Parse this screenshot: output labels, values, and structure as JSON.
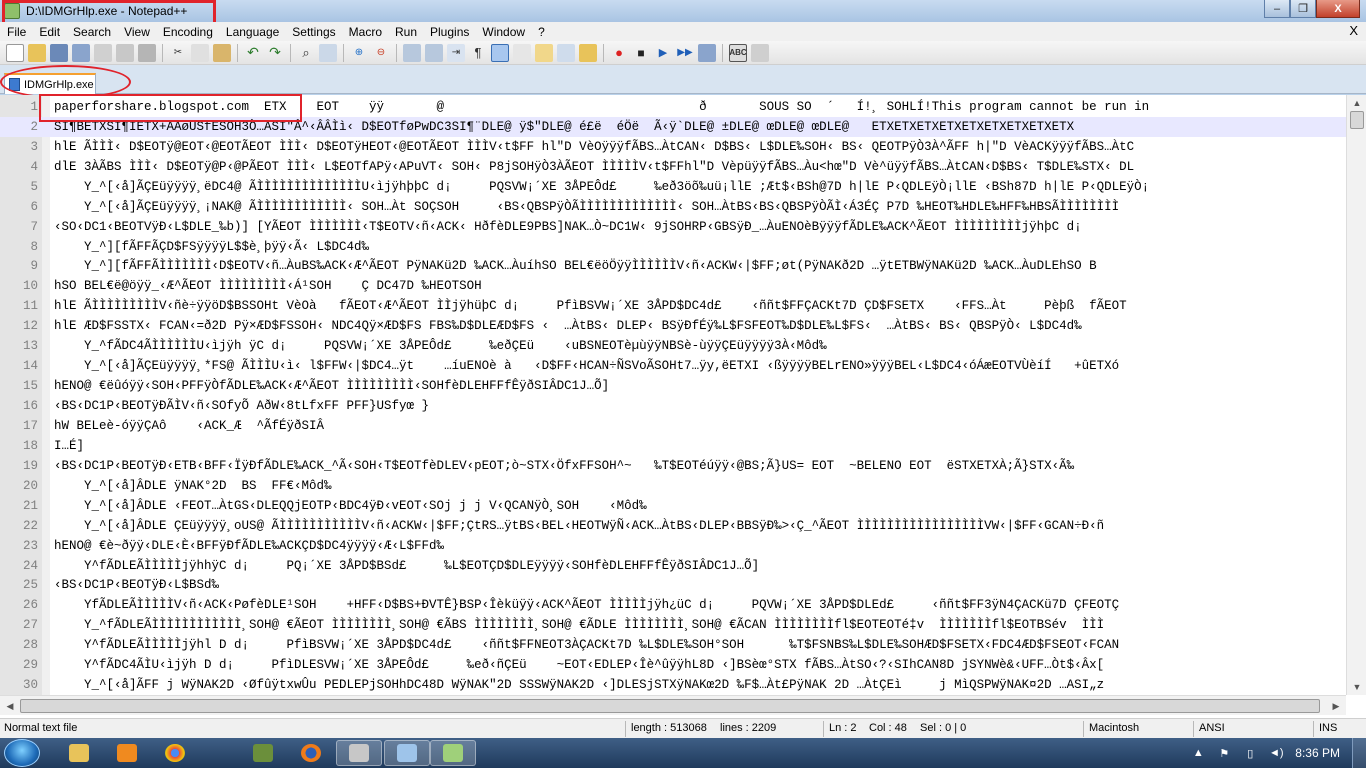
{
  "window": {
    "title": "D:\\IDMGrHlp.exe - Notepad++",
    "controls": {
      "minimize": "–",
      "maximize": "❐",
      "close": "X"
    }
  },
  "menu": [
    "File",
    "Edit",
    "Search",
    "View",
    "Encoding",
    "Language",
    "Settings",
    "Macro",
    "Run",
    "Plugins",
    "Window",
    "?"
  ],
  "menu_close": "X",
  "toolbar": {
    "icons": [
      "new-file-icon",
      "open-file-icon",
      "save-icon",
      "save-all-icon",
      "close-icon",
      "close-all-icon",
      "print-icon",
      "cut-icon",
      "copy-icon",
      "paste-icon",
      "undo-icon",
      "redo-icon",
      "find-icon",
      "replace-icon",
      "zoom-in-icon",
      "zoom-out-icon",
      "sync-vertical-icon",
      "sync-horizontal-icon",
      "word-wrap-icon",
      "show-all-chars-icon",
      "indent-guide-icon",
      "user-lang-icon",
      "doc-map-icon",
      "function-list-icon",
      "folder-workspace-icon",
      "record-macro-icon",
      "stop-macro-icon",
      "play-macro-icon",
      "run-macro-multiple-icon",
      "save-macro-icon",
      "spellcheck-icon",
      "settings-icon"
    ],
    "spellcheck_label": "ABC"
  },
  "tab": {
    "label": "IDMGrHlp.exe"
  },
  "editor": {
    "current_line": 2,
    "lines": [
      {
        "n": "1",
        "text": "paperforshare.blogspot.com  ETX    EOT    ÿÿ       @                                  ð       SOUS SO  ´   Í!¸ SOHLÍ!This program cannot be run in"
      },
      {
        "n": "2",
        "text": "SI¶BETXSI¶IETX+AAøUSfESOH3Ò…ASI\"Â^‹ÂÂÌì‹ D$EOTføPwDC3SI¶¨DLE@ ÿ$\"DLE@ é£ë  éÖë  Ã‹ÿ`DLE@ ±DLE@ œDLE@ œDLE@   ETXETXETXETXETXETXETXETXETX"
      },
      {
        "n": "3",
        "text": "hlE ÃÌÌÌ‹ D$EOTÿ@EOT‹@EOTÃEOT ÌÌÌ‹ D$EOTÿHEOT‹@EOTÃEOT ÌÌÌV‹t$FF hl\"D VèOÿÿÿfÃBS…ÀtCAN‹ D$BS‹ L$DLE‰SOH‹ BS‹ QEOTPÿÒ3À^ÃFF h|\"D VèACKÿÿÿfÃBS…ÀtC"
      },
      {
        "n": "4",
        "text": "dlE 3ÀÃBS ÌÌÌ‹ D$EOTÿ@P‹@PÃEOT ÌÌÌ‹ L$EOTfAPÿ‹APuVT‹ SOH‹ P8jSOHÿÒ3ÀÃEOT ÌÌÌÌÌV‹t$FFhl\"D VèpüÿÿfÃBS…Àu<hœ\"D Vè^üÿÿfÃBS…ÀtCAN‹D$BS‹ T$DLE‰STX‹ DL"
      },
      {
        "n": "5",
        "text": "    Y_^[‹å]ÃÇEüÿÿÿÿ¸ëDC4@ ÃÌÌÌÌÌÌÌÌÌÌÌÌÌÌU‹ìjÿhþþC d¡     PQSVW¡´XE 3ÅPEÔd£     ‰eð3öõ‰uü¡llE ;Æt$‹BSh@7D h|lE P‹QDLEÿÒ¡llE ‹BSh87D h|lE P‹QDLEÿÒ¡"
      },
      {
        "n": "6",
        "text": "    Y_^[‹å]ÃÇEüÿÿÿÿ¸¡NAK@ ÃÌÌÌÌÌÌÌÌÌÌÌÌ‹ SOH…Àt SOÇSOH     ‹BS‹QBSPÿÒÃÌÌÌÌÌÌÌÌÌÌÌÌÌ‹ SOH…ÀtBS‹BS‹QBSPÿÒÃÌ‹Á3ÉÇ P7D ‰HEOT‰HDLE‰HFF‰HBSÃÌÌÌÌÌÌÌÌ"
      },
      {
        "n": "7",
        "text": "‹SO‹DC1‹BEOTVÿÐ‹L$DLE_‰b)] [YÃEOT ÌÌÌÌÌÌÌ‹T$EOTV‹ñ‹ACK‹ HðfèDLE9PBS]NAK…Ò~DC1W‹ 9jSOHRP‹GBSÿÐ_…ÀuENOèBÿÿÿfÃDLE‰ACK^ÃEOT ÌÌÌÌÌÌÌÌÌjÿhþC d¡"
      },
      {
        "n": "8",
        "text": "    Y_^][fÃFFÃÇD$FSÿÿÿÿL$$è¸þÿÿ‹Ã‹ L$DC4d‰"
      },
      {
        "n": "9",
        "text": "    Y_^][fÃFFÃÌÌÌÌÌÌÌ‹D$EOTV‹ñ…ÀuBS‰ACK‹Æ^ÃEOT PÿNAKü2D ‰ACK…ÀuíhSO BEL€ëöÖÿÿÌÌÌÌÌÌV‹ñ‹ACKW‹|$FF;øt(PÿNAKð2D …ÿtETBWÿNAKü2D ‰ACK…ÀuDLEhSO B"
      },
      {
        "n": "10",
        "text": "hSO BEL€ë@öÿÿ_‹Æ^ÃEOT ÌÌÌÌÌÌÌÌÌ‹Á¹SOH    Ç DC47D ‰HEOTSOH"
      },
      {
        "n": "11",
        "text": "hlE ÃÌÌÌÌÌÌÌÌÌV‹ñè÷ÿÿöD$BSSOHt VèOà   fÃEOT‹Æ^ÃEOT ÌÌjÿhüþC d¡     PfìBSVW¡´XE 3ÅPD$DC4d£    ‹ññt$FFÇACKt7D ÇD$FSETX    ‹FFS…Àt     Pèþß  fÃEOT"
      },
      {
        "n": "12",
        "text": "hlE ÆD$FSSTX‹ FCAN‹=ð2D Pÿ×ÆD$FSSOH‹ NDC4Qÿ×ÆD$FS FBS‰D$DLEÆD$FS ‹  …ÀtBS‹ DLEP‹ BSÿÐfÉÿ‰L$FSFEOT‰D$DLE‰L$FS‹  …ÀtBS‹ BS‹ QBSPÿÒ‹ L$DC4d‰"
      },
      {
        "n": "13",
        "text": "    Y_^fÃDC4ÃÌÌÌÌÌÌU‹ìjÿh ÿC d¡     PQSVW¡´XE 3ÅPEÔd£     ‰eðÇEü    ‹uBSNEOTèµùÿÿNBSè-ùÿÿÇEüÿÿÿÿ3À‹Môd‰"
      },
      {
        "n": "14",
        "text": "    Y_^[‹å]ÃÇEüÿÿÿÿ¸*FS@ ÃÌÌÌU‹ì‹ l$FFW‹|$DC4…ÿt    …íuENOè à   ‹D$FF‹HCAN÷ÑSVoÃSOHt7…ÿy,ëETXI ‹ßÿÿÿÿBELrENO»ÿÿÿBEL‹L$DC4‹óÁæEOTVÙèíÍ   +ûETXó"
      },
      {
        "n": "15",
        "text": "hENO@ €ëûóÿÿ‹SOH‹PFFÿÒfÃDLE‰ACK‹Æ^ÃEOT ÌÌÌÌÌÌÌÌÌ‹SOHfèDLEHFFfÊÿðSIÂDC1J…Õ]"
      },
      {
        "n": "16",
        "text": "‹BS‹DC1P‹BEOTÿÐÃÌV‹ñ‹SOfyÕ AðW‹8tLfxFF PFF}USfyœ }"
      },
      {
        "n": "17",
        "text": "hW BELeè-óÿÿÇAô    ‹ACK_Æ  ^ÃfÉÿðSIÂ"
      },
      {
        "n": "18",
        "text": "I…É]"
      },
      {
        "n": "19",
        "text": "‹BS‹DC1P‹BEOTÿÐ‹ETB‹BFF‹ÏÿÐfÃDLE‰ACK_^Ã‹SOH‹T$EOTfèDLEV‹pEOT;ò~STX‹ÖfxFFSOH^~   ‰T$EOTéúÿÿ‹@BS;Ã}US= EOT  ~BELENO EOT  ëSTXETXÀ;Ã}STX‹Ã‰"
      },
      {
        "n": "20",
        "text": "    Y_^[‹å]ÂDLE ÿNAK°2D  BS  FF€‹Môd‰"
      },
      {
        "n": "21",
        "text": "    Y_^[‹å]ÂDLE ‹FEOT…ÀtGS‹DLEQQjEOTP‹BDC4ÿÐ‹vEOT‹SOj j j V‹QCANÿÒ¸SOH    ‹Môd‰"
      },
      {
        "n": "22",
        "text": "    Y_^[‹å]ÂDLE ÇEüÿÿÿÿ¸oUS@ ÃÌÌÌÌÌÌÌÌÌÌÌV‹ñ‹ACKW‹|$FF;ÇtRS…ÿtBS‹BEL‹HEOTWÿÑ‹ACK…ÀtBS‹DLEP‹BBSÿÐ‰>‹Ç_^ÃEOT ÌÌÌÌÌÌÌÌÌÌÌÌÌÌÌÌÌVW‹|$FF‹GCAN÷Ð‹ñ"
      },
      {
        "n": "23",
        "text": "hENO@ €è~ðÿÿ‹DLE‹È‹BFFÿÐfÃDLE‰ACKÇD$DC4ÿÿÿÿ‹Æ‹L$FFd‰"
      },
      {
        "n": "24",
        "text": "    Y^fÃDLEÃÌÌÌÌÌjÿhhÿC d¡     PQ¡´XE 3ÅPD$BSd£     ‰L$EOTÇD$DLEÿÿÿÿ‹SOHfèDLEHFFfÊÿðSIÂDC1J…Õ]"
      },
      {
        "n": "25",
        "text": "‹BS‹DC1P‹BEOTÿÐ‹L$BSd‰"
      },
      {
        "n": "26",
        "text": "    YfÃDLEÃÌÌÌÌÌV‹ñ‹ACK‹PøfèDLE¹SOH    +HFF‹D$BS+ÐVTÊ}BSP‹Îèküÿÿ‹ACK^ÃEOT ÌÌÌÌÌjÿh¿üC d¡     PQVW¡´XE 3ÅPD$DLEd£     ‹ññt$FF3ÿN4ÇACKü7D ÇFEOTÇ"
      },
      {
        "n": "27",
        "text": "    Y_^fÃDLEÃÌÌÌÌÌÌÌÌÌÌÌÌ¸SOH@ €ÃEOT ÌÌÌÌÌÌÌÌ¸SOH@ €ÃBS ÌÌÌÌÌÌÌÌ¸SOH@ €ÃDLE ÌÌÌÌÌÌÌÌ¸SOH@ €ÃCAN ÌÌÌÌÌÌÌÌfl$EOTEOTé‡v  ÌÌÌÌÌÌÌfl$EOTBSév  ÌÌÌ"
      },
      {
        "n": "28",
        "text": "    Y^fÃDLEÃÌÌÌÌÌjÿhl D d¡     PfìBSVW¡´XE 3ÅPD$DC4d£    ‹ññt$FFNEOT3ÀÇACKt7D ‰L$DLE‰SOH°SOH      ‰T$FSNBS‰L$DLE‰SOHÆD$FSETX‹FDC4ÆD$FSEOT‹FCAN"
      },
      {
        "n": "29",
        "text": "    Y^fÃDC4ÃÌU‹ìjÿh D d¡     PfìDLESVW¡´XE 3ÅPEÔd£     ‰eð‹ñÇEü    ~EOT‹EDLEP‹Îè^ûÿÿhL8D ‹]BSèœ°STX fÃBS…ÀtSO‹?‹SIhCAN8D jSYNWè&‹UFF…Òt$‹Âx["
      },
      {
        "n": "30",
        "text": "    Y_^[‹å]ÃFF j WÿNAK2D ‹ØfûÿtxwÛu PEDLEPjSOHhDC48D WÿNAK\"2D SSSWÿNAK2D ‹]DLESjSTXÿNAKœ2D ‰F$…Àt£PÿNAK 2D …ÀtÇEì     j MìQSPWÿNAK¤2D …ASI„z"
      }
    ]
  },
  "status": {
    "file_type": "Normal text file",
    "length": "length : 513068",
    "lines": "lines : 2209",
    "ln": "Ln : 2",
    "col": "Col : 48",
    "sel": "Sel : 0 | 0",
    "eol": "Macintosh",
    "encoding": "ANSI",
    "mode": "INS"
  },
  "taskbar": {
    "apps": [
      "explorer-icon",
      "media-player-icon",
      "chrome-icon",
      "network-tool-icon",
      "firefox-icon",
      "screen-capture-icon",
      "notes-icon",
      "notepad-plus-plus-icon"
    ],
    "tray_icons": [
      "show-hidden-icon",
      "flag-icon",
      "battery-icon",
      "volume-icon"
    ],
    "clock": "8:36 PM"
  },
  "colors": {
    "annotation_red": "#e0232b",
    "title_bar": "#b9d1ea",
    "current_line_bg": "#e8e8ff",
    "gutter": "#e4e4e4",
    "line_number": "#808080"
  }
}
